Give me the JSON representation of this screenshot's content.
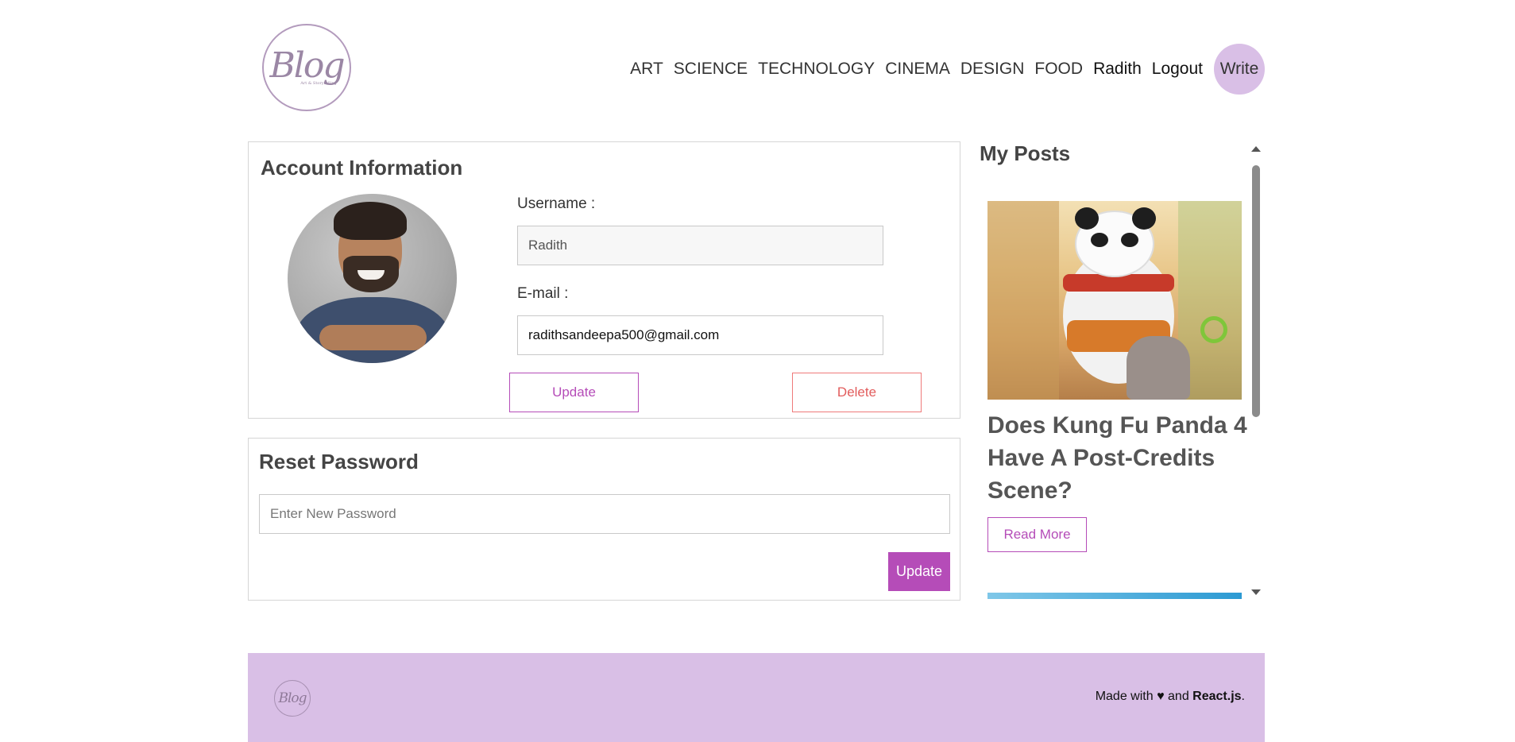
{
  "header": {
    "logo_text": "Blog",
    "logo_subtext": "Art & Storytelling",
    "nav": [
      "ART",
      "SCIENCE",
      "TECHNOLOGY",
      "CINEMA",
      "DESIGN",
      "FOOD"
    ],
    "username": "Radith",
    "logout_label": "Logout",
    "write_label": "Write"
  },
  "account": {
    "title": "Account Information",
    "username_label": "Username :",
    "username_value": "Radith",
    "email_label": "E-mail :",
    "email_value": "radithsandeepa500@gmail.com",
    "update_label": "Update",
    "delete_label": "Delete"
  },
  "reset": {
    "title": "Reset Password",
    "password_placeholder": "Enter New Password",
    "update_label": "Update"
  },
  "posts": {
    "title": "My Posts",
    "items": [
      {
        "title": "Does Kung Fu Panda 4 Have A Post-Credits Scene?",
        "read_more_label": "Read More"
      }
    ]
  },
  "footer": {
    "logo_text": "Blog",
    "made_with": "Made with ♥ and",
    "react_label": "React.js",
    "period": "."
  },
  "colors": {
    "accent": "#b54cb8",
    "lavender": "#d9bfe6",
    "delete": "#e25c5c"
  }
}
